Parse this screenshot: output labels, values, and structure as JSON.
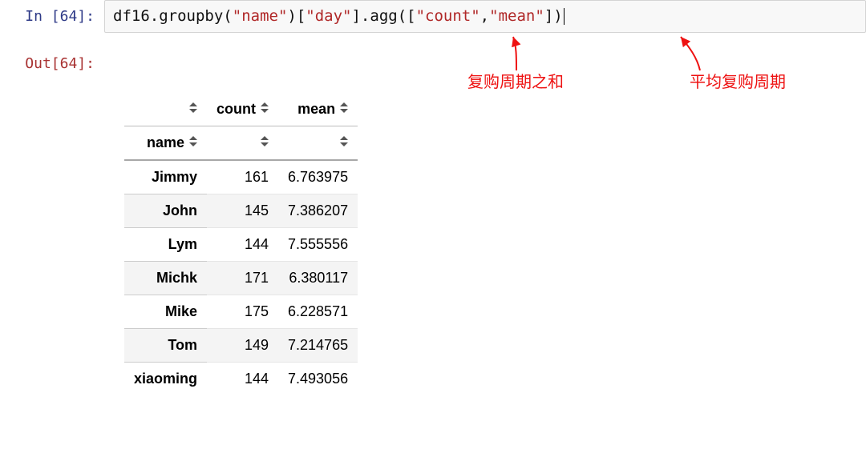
{
  "input": {
    "prompt": "In [64]:",
    "code": {
      "obj": "df16",
      "m1": "groupby",
      "s1": "\"name\"",
      "s2": "\"day\"",
      "m2": "agg",
      "s3": "\"count\"",
      "s4": "\"mean\""
    }
  },
  "output": {
    "prompt": "Out[64]:"
  },
  "table": {
    "columns": [
      "count",
      "mean"
    ],
    "index_name": "name",
    "rows": [
      {
        "name": "Jimmy",
        "count": "161",
        "mean": "6.763975"
      },
      {
        "name": "John",
        "count": "145",
        "mean": "7.386207"
      },
      {
        "name": "Lym",
        "count": "144",
        "mean": "7.555556"
      },
      {
        "name": "Michk",
        "count": "171",
        "mean": "6.380117"
      },
      {
        "name": "Mike",
        "count": "175",
        "mean": "6.228571"
      },
      {
        "name": "Tom",
        "count": "149",
        "mean": "7.214765"
      },
      {
        "name": "xiaoming",
        "count": "144",
        "mean": "7.493056"
      }
    ]
  },
  "annotations": {
    "a1": "复购周期之和",
    "a2": "平均复购周期"
  }
}
